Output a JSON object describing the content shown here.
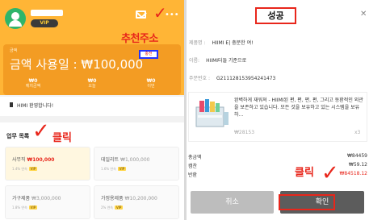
{
  "left": {
    "header": {
      "vip_badge": "VIP",
      "annotation": "추천주소"
    },
    "balance": {
      "label": "금액",
      "text": "금액 사용일 : ₩100,000",
      "charge_button": "충전",
      "stats": [
        {
          "value": "₩0",
          "label": "예치금액"
        },
        {
          "value": "₩0",
          "label": "오늘"
        },
        {
          "value": "₩0",
          "label": "이번"
        }
      ]
    },
    "notice": "HIMI 환영합니다!",
    "tasks": {
      "title": "업무 목록",
      "annotation": "클릭",
      "items": [
        {
          "name": "사무직",
          "price": "₩100,000",
          "meta": "1.4% 연속",
          "tag": "VIP"
        },
        {
          "name": "데일리트",
          "price": "₩1,000,000",
          "meta": "1.6% 연속",
          "tag": "VIP"
        },
        {
          "name": "가구제품",
          "price": "₩3,000,000",
          "meta": "1.8% 연속",
          "tag": "VIP"
        },
        {
          "name": "가정용제품",
          "price": "₩10,200,000",
          "meta": "2% 연속",
          "tag": "VIP"
        }
      ]
    }
  },
  "right": {
    "title": "성공",
    "close_icon": "close-icon",
    "info": [
      {
        "label": "제품명 :",
        "value": "HIIMI E| 충분한 여!"
      },
      {
        "label": "이름:",
        "value": "HIIMI터들 기준으로"
      },
      {
        "label": "주문번호 :",
        "value": "G211128153954241473"
      }
    ],
    "product": {
      "description": "완벽하게 재워져 - HIIMI된 편, 편, 편, 편, 그리고 동환적인 외관을 보존하고 있습니다. 모든 것을 보유하고 있는 시스템을 보유하...",
      "price": "₩28153",
      "qty": "x3"
    },
    "summary": [
      {
        "label": "총금액",
        "value": "₩84459",
        "red": false
      },
      {
        "label": "캠찬",
        "value": "₩59.12",
        "red": false
      },
      {
        "label": "반환",
        "value": "₩84518.12",
        "red": true
      }
    ],
    "annotation": "클릭",
    "cancel_label": "취소",
    "confirm_label": "확인"
  },
  "colors": {
    "accent_orange": "#f39c23",
    "annotation_red": "#e8261b",
    "confirm_dark": "#5c5c5c",
    "cancel_grey": "#bdbdbd"
  }
}
